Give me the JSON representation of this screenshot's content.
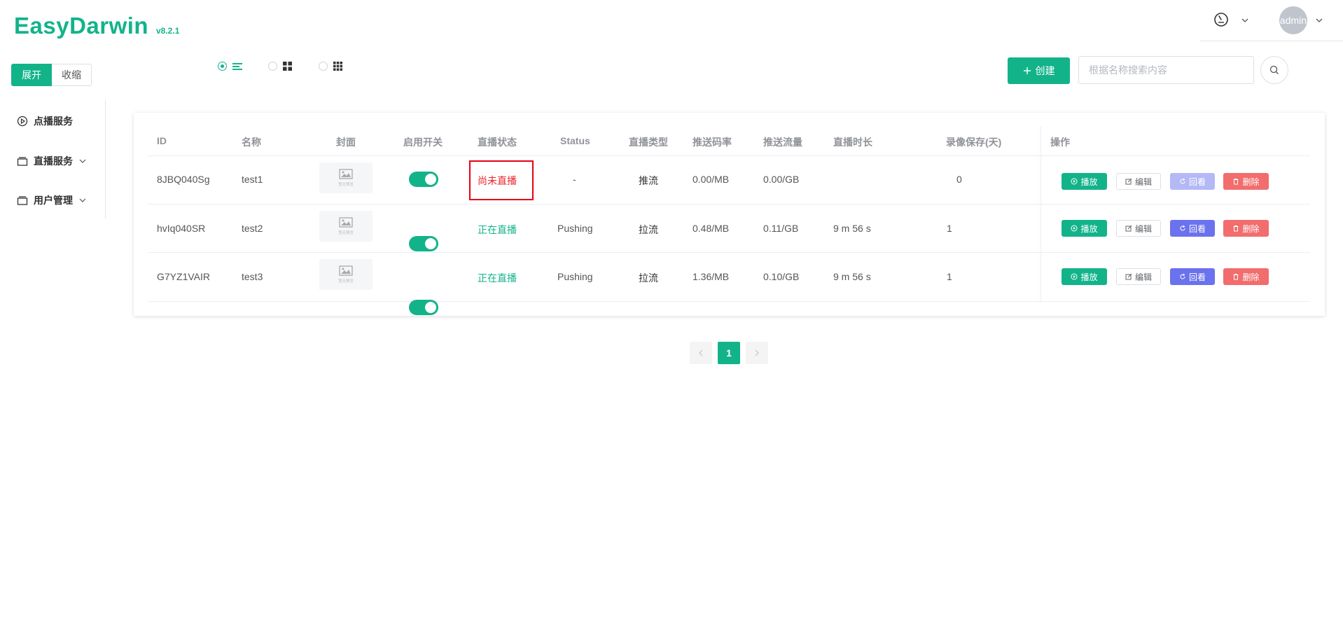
{
  "app": {
    "name": "EasyDarwin",
    "version": "v8.2.1"
  },
  "header": {
    "user": "admin"
  },
  "toggle": {
    "expand": "展开",
    "collapse": "收缩"
  },
  "toolbar": {
    "create_label": "创建",
    "search_placeholder": "根据名称搜索内容"
  },
  "sidebar": {
    "items": [
      {
        "label": "点播服务",
        "icon": "play-circle-icon",
        "has_children": false
      },
      {
        "label": "直播服务",
        "icon": "folder-icon",
        "has_children": true
      },
      {
        "label": "用户管理",
        "icon": "folder-icon",
        "has_children": true
      }
    ]
  },
  "table": {
    "columns": [
      "ID",
      "名称",
      "封面",
      "启用开关",
      "直播状态",
      "Status",
      "直播类型",
      "推送码率",
      "推送流量",
      "直播时长",
      "录像保存(天)",
      "操作"
    ],
    "cover_placeholder": "暂无预览",
    "rows": [
      {
        "id": "8JBQ040Sg",
        "name": "test1",
        "enabled": true,
        "live_status": "尚未直播",
        "status": "-",
        "type": "推流",
        "bitrate": "0.00/MB",
        "traffic": "0.00/GB",
        "duration": "",
        "record_days": "0",
        "replay_enabled": false
      },
      {
        "id": "hvIq040SR",
        "name": "test2",
        "enabled": true,
        "live_status": "正在直播",
        "status": "Pushing",
        "type": "拉流",
        "bitrate": "0.48/MB",
        "traffic": "0.11/GB",
        "duration": "9 m 56 s",
        "record_days": "1",
        "replay_enabled": true
      },
      {
        "id": "G7YZ1VAIR",
        "name": "test3",
        "enabled": true,
        "live_status": "正在直播",
        "status": "Pushing",
        "type": "拉流",
        "bitrate": "1.36/MB",
        "traffic": "0.10/GB",
        "duration": "9 m 56 s",
        "record_days": "1",
        "replay_enabled": true
      }
    ],
    "actions": {
      "play": "播放",
      "edit": "编辑",
      "replay": "回看",
      "delete": "删除"
    }
  },
  "pagination": {
    "current": "1",
    "total_pages": 1
  },
  "colors": {
    "primary": "#13b38a",
    "replay": "#6b72ed",
    "danger": "#f26d6d",
    "status_off": "#e8232c"
  }
}
